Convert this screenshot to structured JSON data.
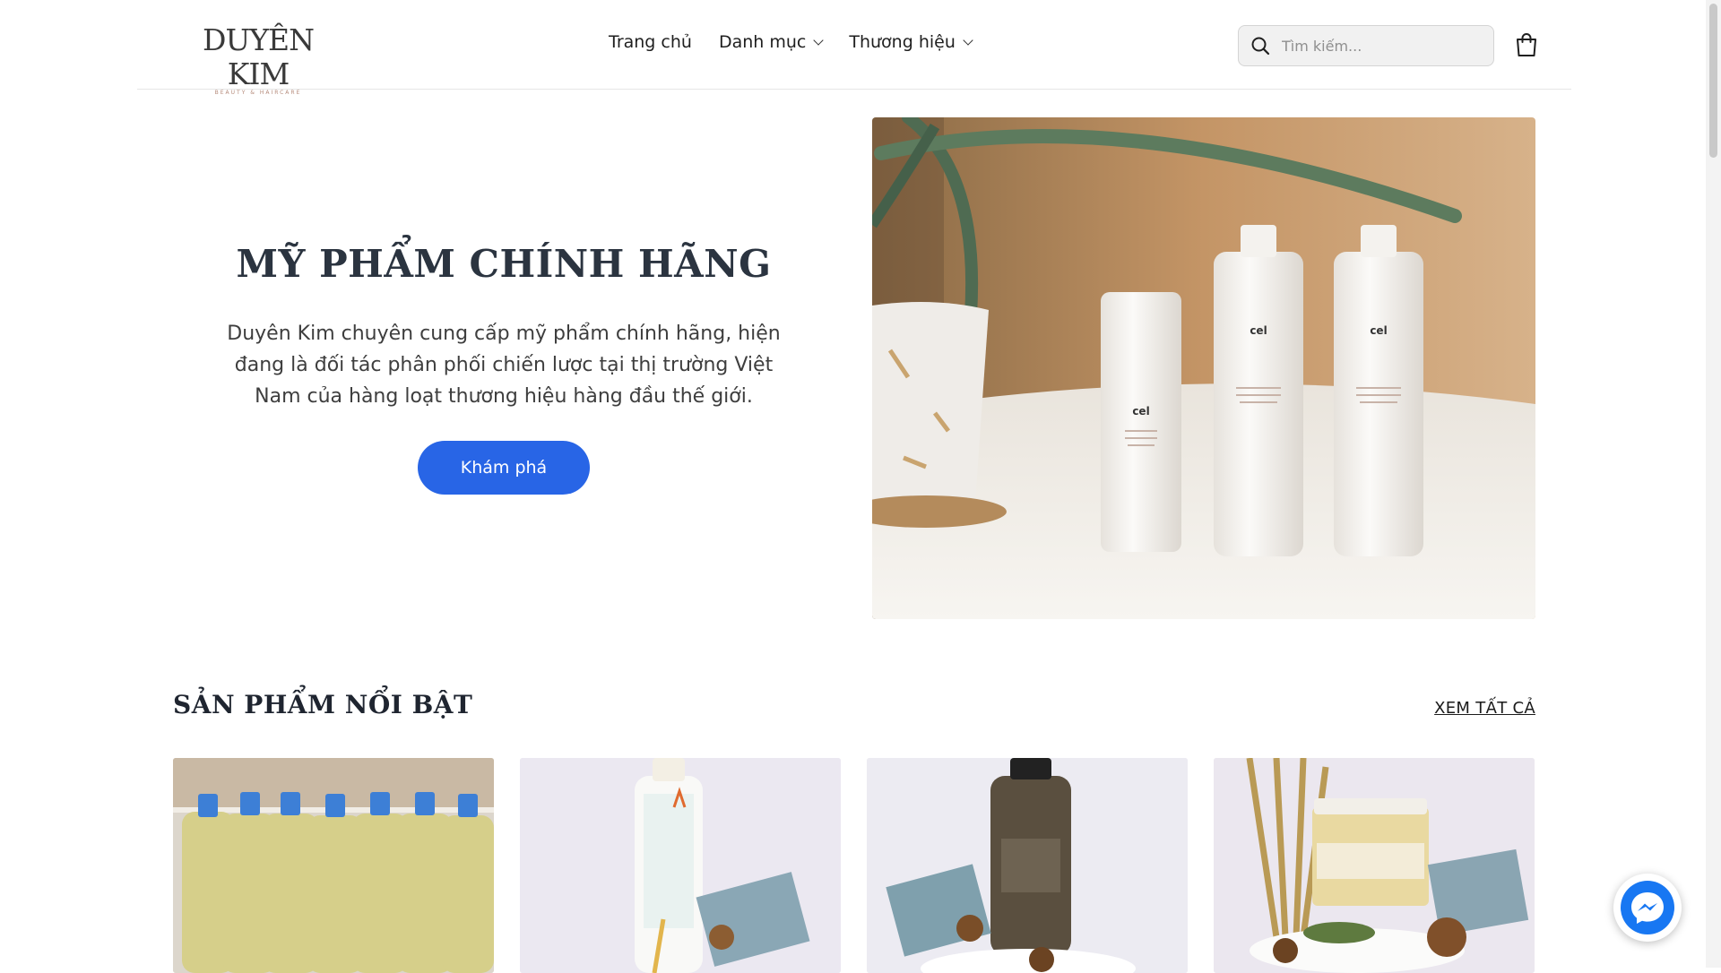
{
  "brand": {
    "logo_text": "DUYÊN KIM",
    "logo_tagline": "BEAUTY & HAIRCARE"
  },
  "nav": {
    "items": [
      {
        "label": "Trang chủ",
        "has_dropdown": false
      },
      {
        "label": "Danh mục",
        "has_dropdown": true
      },
      {
        "label": "Thương hiệu",
        "has_dropdown": true
      }
    ]
  },
  "search": {
    "placeholder": "Tìm kiếm...",
    "value": ""
  },
  "hero": {
    "title": "MỸ PHẨM CHÍNH HÃNG",
    "description": "Duyên Kim chuyên cung cấp mỹ phẩm chính hãng, hiện đang là đối tác phân phối chiến lược tại thị trường Việt Nam của hàng loạt thương hiệu hàng đầu thế giới.",
    "button_label": "Khám phá",
    "image_bottle_label": "cel"
  },
  "featured": {
    "title": "SẢN PHẨM NỔI BẬT",
    "view_all": "XEM TẤT CẢ"
  },
  "colors": {
    "accent": "#2865e6",
    "messenger": "#1877f2"
  },
  "icons": [
    "search-icon",
    "shopping-bag-icon",
    "chevron-down-icon",
    "messenger-icon"
  ]
}
